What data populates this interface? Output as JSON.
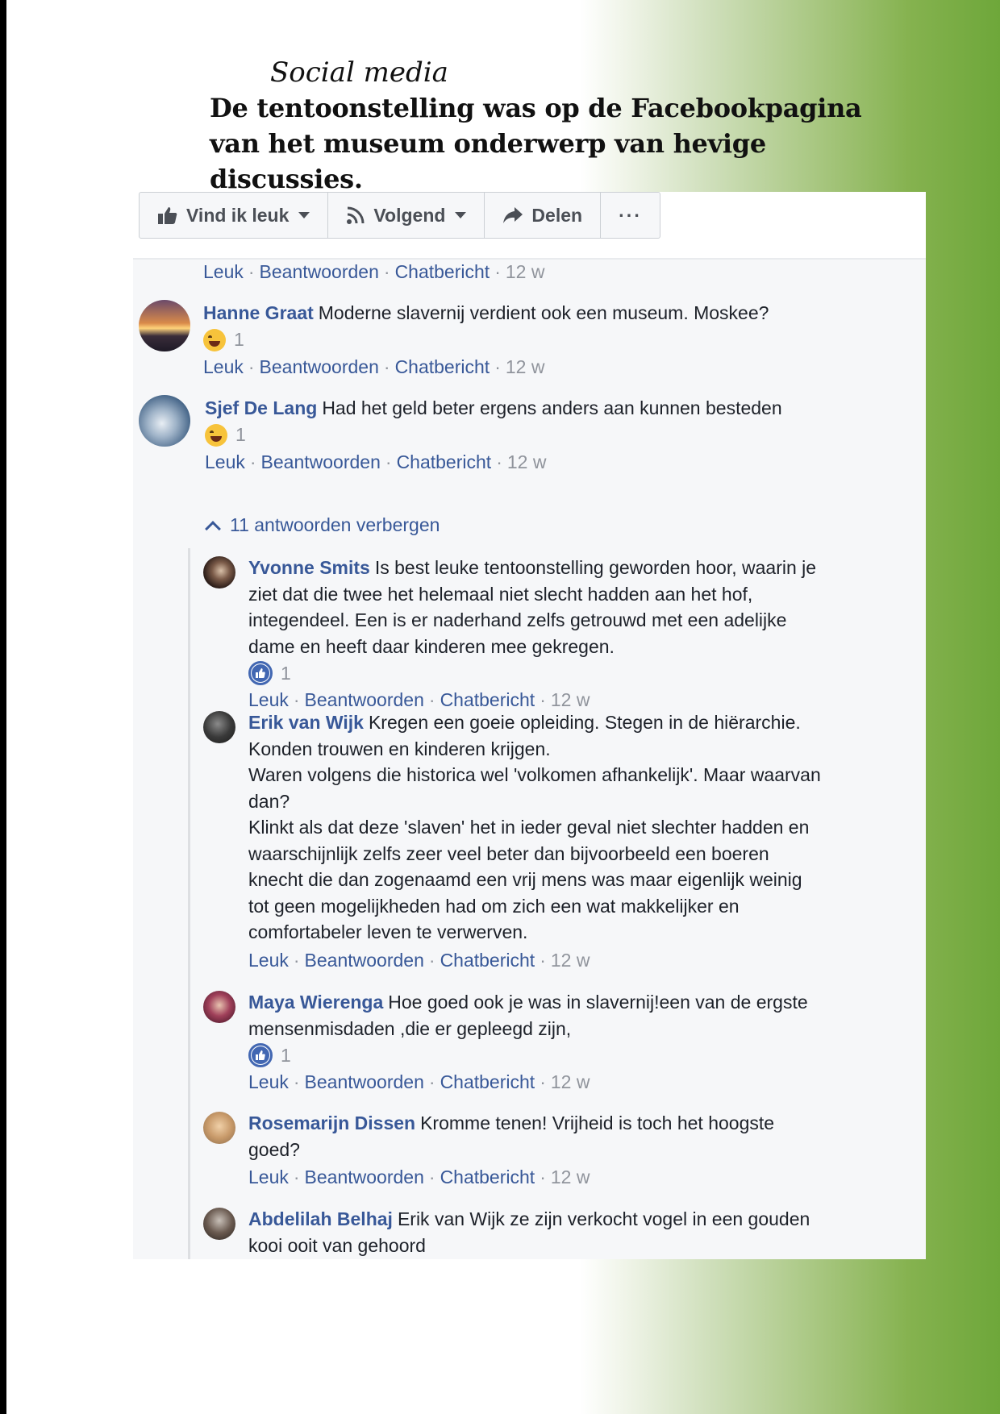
{
  "heading": {
    "kicker": "Social media",
    "lede": "De tentoonstelling was op de Facebookpagina van het museum onderwerp van hevige discussies."
  },
  "toolbar": {
    "like_label": "Vind ik leuk",
    "follow_label": "Volgend",
    "share_label": "Delen",
    "more_label": "···"
  },
  "action_labels": {
    "like": "Leuk",
    "reply": "Beantwoorden",
    "chat": "Chatbericht",
    "sep": "·"
  },
  "top_actions": {
    "time": "12 w"
  },
  "comments": [
    {
      "author": "Hanne Graat",
      "text": "Moderne slavernij verdient ook een museum. Moskee?",
      "reaction": "haha",
      "reaction_count": "1",
      "time": "12 w"
    },
    {
      "author": "Sjef De Lang",
      "text": "Had het geld beter ergens anders aan kunnen besteden",
      "reaction": "haha",
      "reaction_count": "1",
      "time": "12 w"
    }
  ],
  "replies_toggle": "11 antwoorden verbergen",
  "replies": [
    {
      "author": "Yvonne Smits",
      "lines": [
        "Is best leuke tentoonstelling geworden hoor, waarin je",
        "ziet dat die twee het helemaal niet slecht hadden aan het hof,",
        "integendeel. Een is er naderhand zelfs getrouwd met een adelijke",
        "dame en heeft daar kinderen mee gekregen."
      ],
      "reaction": "like",
      "reaction_count": "1",
      "time": "12 w"
    },
    {
      "author": "Erik van Wijk",
      "lines": [
        "Kregen een goeie opleiding. Stegen in de hiërarchie.",
        "Konden trouwen en kinderen krijgen.",
        "Waren volgens die historica wel 'volkomen afhankelijk'. Maar waarvan",
        "dan?",
        "Klinkt als dat deze 'slaven' het in ieder geval niet slechter hadden en",
        "waarschijnlijk zelfs zeer veel beter dan bijvoorbeeld een boeren",
        "knecht die dan zogenaamd een vrij mens was maar eigenlijk weinig",
        "tot geen mogelijkheden had om zich een wat makkelijker en",
        "comfortabeler leven te verwerven."
      ],
      "time": "12 w"
    },
    {
      "author": "Maya Wierenga",
      "lines": [
        "Hoe goed ook je was in slavernij!een van de ergste",
        "mensenmisdaden ,die er gepleegd zijn,"
      ],
      "reaction": "like",
      "reaction_count": "1",
      "time": "12 w"
    },
    {
      "author": "Rosemarijn Dissen",
      "lines": [
        "Kromme tenen! Vrijheid is toch het hoogste",
        "goed?"
      ],
      "time": "12 w"
    },
    {
      "author": "Abdelilah Belhaj",
      "lines": [
        "Erik van Wijk ze zijn verkocht vogel in een gouden",
        "kooi ooit van gehoord"
      ]
    }
  ],
  "colors": {
    "link_blue": "#385898",
    "meta_gray": "#90949c",
    "text": "#1d2129",
    "accent_green": "#6ea73a"
  }
}
